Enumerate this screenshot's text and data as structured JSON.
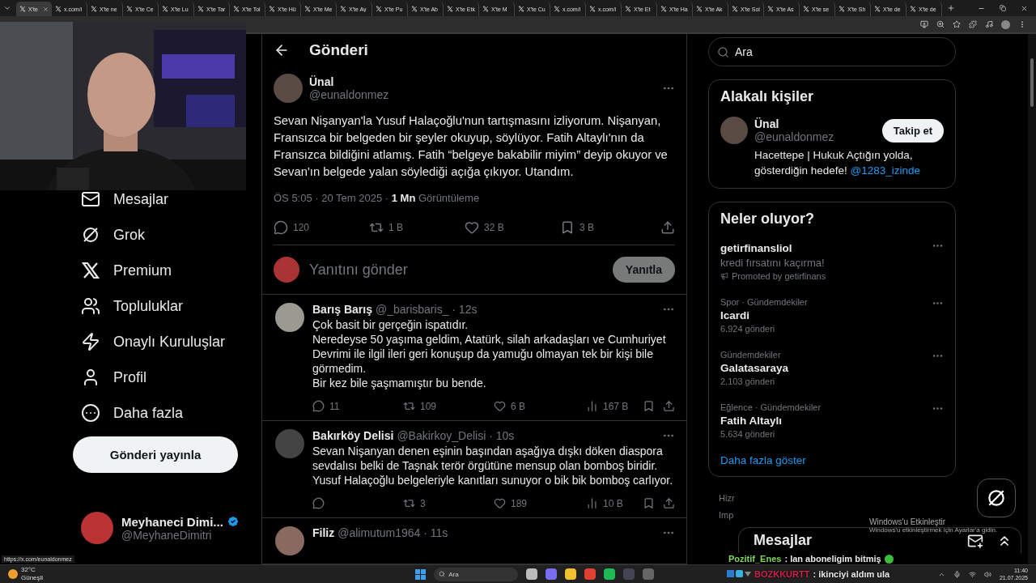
{
  "browser": {
    "tabs": [
      {
        "title": "X'te",
        "selected": true
      },
      {
        "title": "x.com/i",
        "selected": false
      },
      {
        "title": "X'te ne",
        "selected": false
      },
      {
        "title": "X'te Ce",
        "selected": false
      },
      {
        "title": "X'te Lu",
        "selected": false
      },
      {
        "title": "X'te Tar",
        "selected": false
      },
      {
        "title": "X'te Tol",
        "selected": false
      },
      {
        "title": "X'te Hü",
        "selected": false
      },
      {
        "title": "X'te Me",
        "selected": false
      },
      {
        "title": "X'te Ay",
        "selected": false
      },
      {
        "title": "X'te Pu",
        "selected": false
      },
      {
        "title": "X'te Ab",
        "selected": false
      },
      {
        "title": "X'te Etk",
        "selected": false
      },
      {
        "title": "X'te M",
        "selected": false
      },
      {
        "title": "X'te Cu",
        "selected": false
      },
      {
        "title": "x.com/i",
        "selected": false
      },
      {
        "title": "x.com/i",
        "selected": false
      },
      {
        "title": "X'te Et",
        "selected": false
      },
      {
        "title": "X'te Ha",
        "selected": false
      },
      {
        "title": "X'te Ak",
        "selected": false
      },
      {
        "title": "X'te Sol",
        "selected": false
      },
      {
        "title": "X'te As",
        "selected": false
      },
      {
        "title": "X'te se",
        "selected": false
      },
      {
        "title": "X'te Sh",
        "selected": false
      },
      {
        "title": "X'te de",
        "selected": false
      },
      {
        "title": "X'te de",
        "selected": false
      }
    ],
    "status_url": "https://x.com/eunaldonmez"
  },
  "nav": {
    "items": [
      {
        "kind": "mail",
        "label": "Mesajlar"
      },
      {
        "kind": "grok",
        "label": "Grok"
      },
      {
        "kind": "premium",
        "label": "Premium"
      },
      {
        "kind": "communities",
        "label": "Topluluklar"
      },
      {
        "kind": "organizations",
        "label": "Onaylı Kuruluşlar"
      },
      {
        "kind": "profile",
        "label": "Profil"
      },
      {
        "kind": "more",
        "label": "Daha fazla"
      }
    ],
    "post_button": "Gönderi yayınla",
    "account": {
      "name": "Meyhaneci Dimi...",
      "handle": "@MeyhaneDimitri",
      "verified": true
    }
  },
  "main": {
    "title": "Gönderi",
    "post": {
      "name": "Ünal",
      "handle": "@eunaldonmez",
      "text": "Sevan Nişanyan'la Yusuf Halaçoğlu'nun tartışmasını izliyorum. Nişanyan, Fransızca bir belgeden bir şeyler okuyup, söylüyor. Fatih Altaylı'nın da Fransızca bildiğini atlamış. Fatih “belgeye bakabilir miyim” deyip okuyor ve Sevan'ın belgede yalan söylediği açığa çıkıyor. Utandım.",
      "meta": "ÖS 5:05 · 20 Tem 2025 · **1 Mn** Görüntüleme",
      "replies": "120",
      "reposts": "1 B",
      "likes": "32 B",
      "bookmarks": "3 B"
    },
    "reply_box": {
      "placeholder": "Yanıtını gönder",
      "button": "Yanıtla",
      "disabled": true
    },
    "replies": [
      {
        "name": "Barış Barış",
        "handle": "@_barisbaris_ · 12s",
        "text": "Çok basit bir gerçeğin ispatıdır.\nNeredeyse 50  yaşıma geldim, Atatürk, silah arkadaşları ve Cumhuriyet Devrimi ile ilgil ileri geri konuşup da yamuğu olmayan tek bir kişi bile görmedim.\nBir kez bile şaşmamıştır bu bende.",
        "replies": "11",
        "reposts": "109",
        "likes": "6 B",
        "views": "167 B"
      },
      {
        "name": "Bakırköy Delisi",
        "handle": "@Bakirkoy_Delisi · 10s",
        "text": "Sevan Nişanyan denen eşinin başından aşağıya dışkı döken diaspora sevdalısı belki de Taşnak terör örgütüne mensup olan bomboş biridir. Yusuf Halaçoğlu belgeleriyle kanıtları sunuyor o bik bik bomboş carlıyor.",
        "reposts": "3",
        "likes": "189",
        "views": "10 B"
      },
      {
        "name": "Filiz",
        "handle": "@alimutum1964 · 11s"
      }
    ]
  },
  "sidebar": {
    "search_placeholder": "Ara",
    "people": {
      "title": "Alakalı kişiler",
      "name": "Ünal",
      "handle": "@eunaldonmez",
      "follow": "Takip et",
      "bio": "Hacettepe | Hukuk Açtığın yolda, gösterdiğin hedefe!",
      "bio_link": "@1283_izinde"
    },
    "trends": {
      "title": "Neler oluyor?",
      "items": [
        {
          "kind": "ad",
          "title": "getirfinansliol",
          "text": "kredi fırsatını kaçırma!",
          "note": "Promoted by getirfinans"
        },
        {
          "kind": "trend",
          "context": "Spor · Gündemdekiler",
          "title": "Icardi",
          "count": "6.924 gönderi"
        },
        {
          "kind": "trend",
          "context": "Gündemdekiler",
          "title": "Galatasaraya",
          "count": "2.103 gönderi"
        },
        {
          "kind": "trend",
          "context": "Eğlence · Gündemdekiler",
          "title": "Fatih Altaylı",
          "count": "5.634 gönderi"
        }
      ],
      "more": "Daha fazla göster"
    },
    "footer": [
      "Hizr",
      "Imp"
    ]
  },
  "messages_drawer": {
    "title": "Mesajlar"
  },
  "activation_notice": {
    "title": "Windows'u Etkinleştir",
    "text": "Windows'u etkinleştirmek için Ayarlar'a gidin."
  },
  "chat": [
    {
      "user": "Pozitif_Enes",
      "color": "#7ed957",
      "text": ": lan aboneligim bitmiş"
    },
    {
      "user": "BOZKKURTT",
      "color": "#d0204a",
      "text": ": ikinciyi aldım ula"
    }
  ],
  "taskbar": {
    "temperature": "32°C",
    "weather": "Güneşli",
    "search": "Ara",
    "time": "11:40",
    "date": "21.07.2025"
  }
}
